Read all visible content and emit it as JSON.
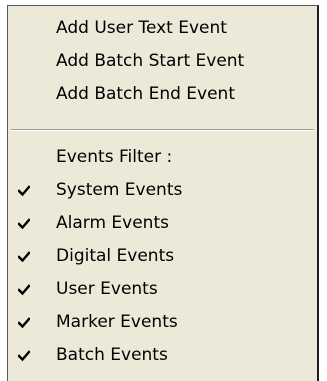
{
  "menu": {
    "actions": [
      {
        "label": "Add User Text Event"
      },
      {
        "label": "Add Batch Start Event"
      },
      {
        "label": "Add Batch End Event"
      }
    ],
    "filter_header": "Events Filter :",
    "filters": [
      {
        "label": "System Events",
        "checked": true,
        "icon": "checkmark-icon"
      },
      {
        "label": "Alarm Events",
        "checked": true,
        "icon": "checkmark-icon"
      },
      {
        "label": "Digital Events",
        "checked": true,
        "icon": "checkmark-icon"
      },
      {
        "label": "User Events",
        "checked": true,
        "icon": "checkmark-icon"
      },
      {
        "label": "Marker Events",
        "checked": true,
        "icon": "checkmark-icon"
      },
      {
        "label": "Batch Events",
        "checked": true,
        "icon": "checkmark-icon"
      }
    ],
    "colors": {
      "background": "#ece9d8",
      "text": "#000000"
    }
  }
}
